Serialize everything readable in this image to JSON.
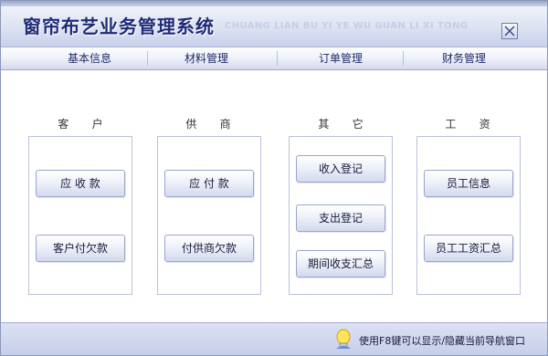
{
  "window": {
    "title": "窗帘布艺业务管理系统",
    "subtitle": "CHUANG LIAN BU YI YE WU GUAN LI XI TONG"
  },
  "nav": {
    "tabs": [
      {
        "label": "基本信息"
      },
      {
        "label": "材料管理"
      },
      {
        "label": "订单管理"
      },
      {
        "label": "财务管理",
        "active": true
      }
    ]
  },
  "groups": [
    {
      "title": "客    户",
      "buttons": [
        "应 收 款",
        "客户付欠款"
      ]
    },
    {
      "title": "供    商",
      "buttons": [
        "应 付 款",
        "付供商欠款"
      ]
    },
    {
      "title": "其    它",
      "buttons": [
        "收入登记",
        "支出登记",
        "期间收支汇总"
      ]
    },
    {
      "title": "工    资",
      "buttons": [
        "员工信息",
        "员工工资汇总"
      ]
    }
  ],
  "status": {
    "text": "使用F8键可以显示/隐藏当前导航窗口",
    "icon": "lightbulb-icon"
  },
  "colors": {
    "title": "#1f2b78",
    "accent": "#c9d1eb",
    "nav_text": "#1f2b6a"
  }
}
